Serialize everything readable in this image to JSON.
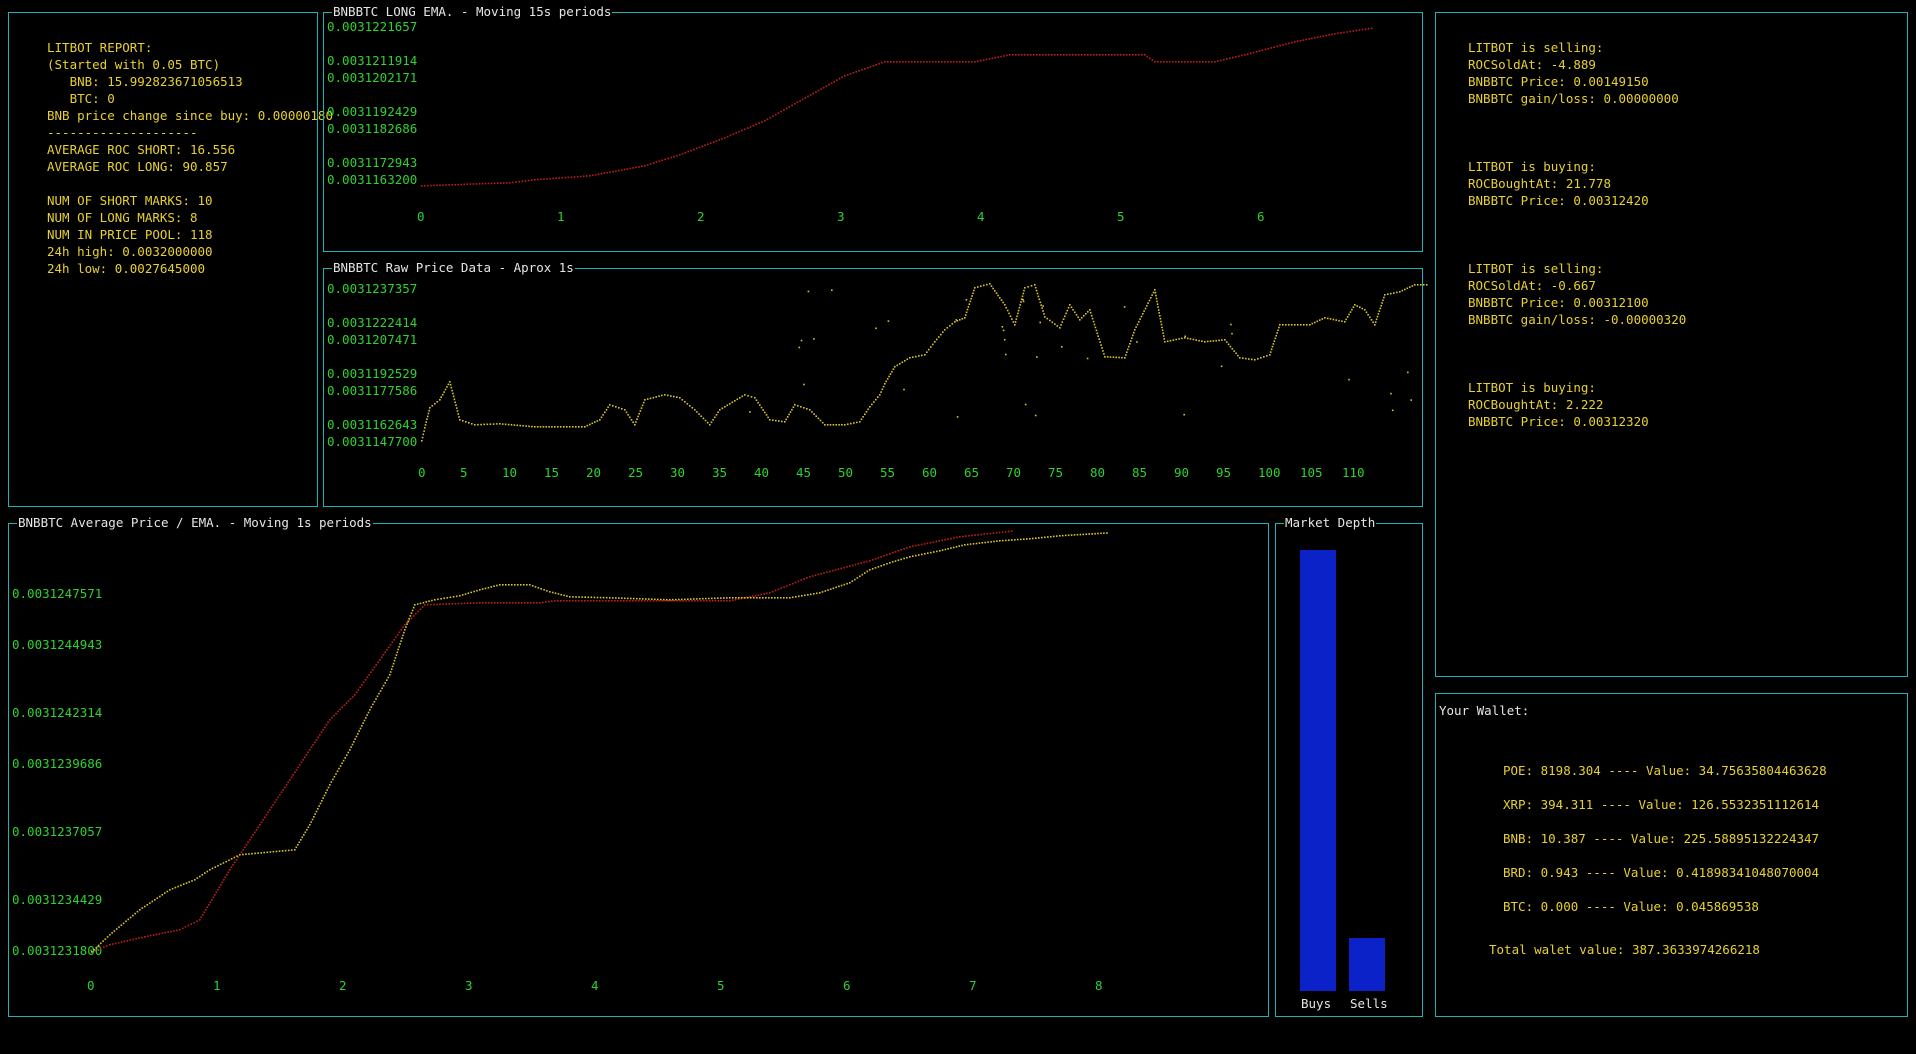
{
  "report": {
    "lines": [
      "LITBOT REPORT:",
      "(Started with 0.05 BTC)",
      "   BNB: 15.992823671056513",
      "   BTC: 0",
      "BNB price change since buy: 0.00000180",
      "--------------------",
      "AVERAGE ROC SHORT: 16.556",
      "AVERAGE ROC LONG: 90.857",
      "",
      "NUM OF SHORT MARKS: 10",
      "NUM OF LONG MARKS: 8",
      "NUM IN PRICE POOL: 118",
      "24h high: 0.0032000000",
      "24h low: 0.0027645000"
    ]
  },
  "long_ema": {
    "title": "BNBBTC LONG EMA. - Moving 15s periods",
    "y_labels": [
      "0.0031221657",
      "0.0031211914",
      "0.0031202171",
      "0.0031192429",
      "0.0031182686",
      "0.0031172943",
      "0.0031163200"
    ],
    "x_labels": [
      "0",
      "1",
      "2",
      "3",
      "4",
      "5",
      "6"
    ]
  },
  "raw_price": {
    "title": "BNBBTC Raw Price Data - Aprox 1s",
    "y_labels": [
      "0.0031237357",
      "0.0031222414",
      "0.0031207471",
      "0.0031192529",
      "0.0031177586",
      "0.0031162643",
      "0.0031147700"
    ],
    "x_labels": [
      "0",
      "5",
      "10",
      "15",
      "20",
      "25",
      "30",
      "35",
      "40",
      "45",
      "50",
      "55",
      "60",
      "65",
      "70",
      "75",
      "80",
      "85",
      "90",
      "95",
      "100",
      "105",
      "110"
    ]
  },
  "avg_price": {
    "title": "BNBBTC Average Price / EMA. - Moving 1s periods",
    "y_labels": [
      "0.0031247571",
      "0.0031244943",
      "0.0031242314",
      "0.0031239686",
      "0.0031237057",
      "0.0031234429",
      "0.0031231800"
    ],
    "x_labels": [
      "0",
      "1",
      "2",
      "3",
      "4",
      "5",
      "6",
      "7",
      "8"
    ]
  },
  "market_depth": {
    "title": "Market Depth",
    "bars": [
      {
        "label": "Buys",
        "value": 100
      },
      {
        "label": "Sells",
        "value": 12
      }
    ],
    "bar_color": "#0a22c8"
  },
  "trades": {
    "lines": [
      "LITBOT is selling:",
      "ROCSoldAt: -4.889",
      "BNBBTC Price: 0.00149150",
      "BNBBTC gain/loss: 0.00000000",
      "",
      "",
      "",
      "LITBOT is buying:",
      "ROCBoughtAt: 21.778",
      "BNBBTC Price: 0.00312420",
      "",
      "",
      "",
      "LITBOT is selling:",
      "ROCSoldAt: -0.667",
      "BNBBTC Price: 0.00312100",
      "BNBBTC gain/loss: -0.00000320",
      "",
      "",
      "",
      "LITBOT is buying:",
      "ROCBoughtAt: 2.222",
      "BNBBTC Price: 0.00312320"
    ]
  },
  "wallet": {
    "title": "Your Wallet:",
    "items": [
      "POE: 8198.304 ---- Value: 34.75635804463628",
      "XRP: 394.311 ---- Value: 126.5532351112614",
      "BNB: 10.387 ---- Value: 225.58895132224347",
      "BRD: 0.943 ---- Value: 0.41898341048070004",
      "BTC: 0.000 ---- Value: 0.045869538"
    ],
    "total": "Total walet value: 387.3633974266218"
  },
  "colors": {
    "border": "#1fb3b8",
    "text_yellow": "#e8d12e",
    "axis_green": "#2fd12f",
    "series_red": "#c0201a",
    "series_yellow": "#d8c42a"
  }
}
